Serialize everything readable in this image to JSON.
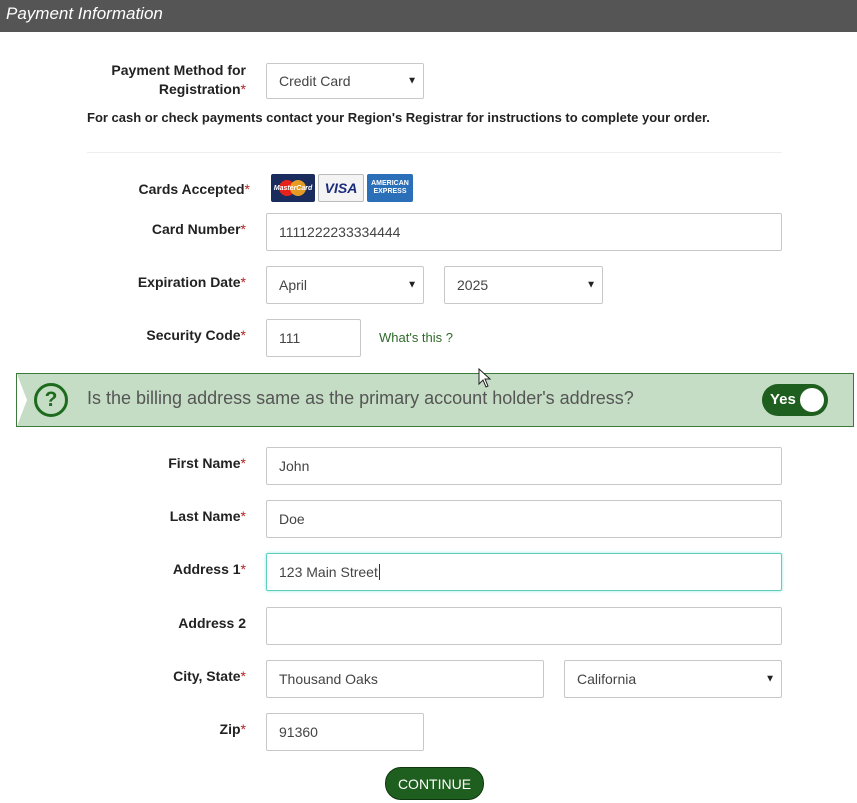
{
  "header": {
    "title": "Payment Information"
  },
  "payment": {
    "method_label": "Payment Method for Registration",
    "method_value": "Credit Card",
    "note": "For cash or check payments contact your Region's Registrar for instructions to complete your order."
  },
  "cards": {
    "label": "Cards Accepted",
    "mastercard": "MasterCard",
    "visa": "VISA",
    "amex": "AMERICAN EXPRESS"
  },
  "card_number": {
    "label": "Card Number",
    "value": "1111222233334444"
  },
  "expiration": {
    "label": "Expiration Date",
    "month": "April",
    "year": "2025"
  },
  "security": {
    "label": "Security Code",
    "value": "111",
    "help_link": "What's this ?"
  },
  "billing_question": {
    "icon": "?",
    "text": "Is the billing address same as the primary account holder's address?",
    "toggle_label": "Yes"
  },
  "billing": {
    "first_name": {
      "label": "First Name",
      "value": "John"
    },
    "last_name": {
      "label": "Last Name",
      "value": "Doe"
    },
    "address1": {
      "label": "Address 1",
      "value": "123 Main Street"
    },
    "address2": {
      "label": "Address 2",
      "value": ""
    },
    "city_state": {
      "label": "City, State",
      "city": "Thousand Oaks",
      "state": "California"
    },
    "zip": {
      "label": "Zip",
      "value": "91360"
    }
  },
  "continue_label": "CONTINUE",
  "colors": {
    "accent": "#1e5e1e",
    "banner_bg": "#c5ddc5",
    "header_bg": "#555555",
    "required": "#b22222"
  }
}
